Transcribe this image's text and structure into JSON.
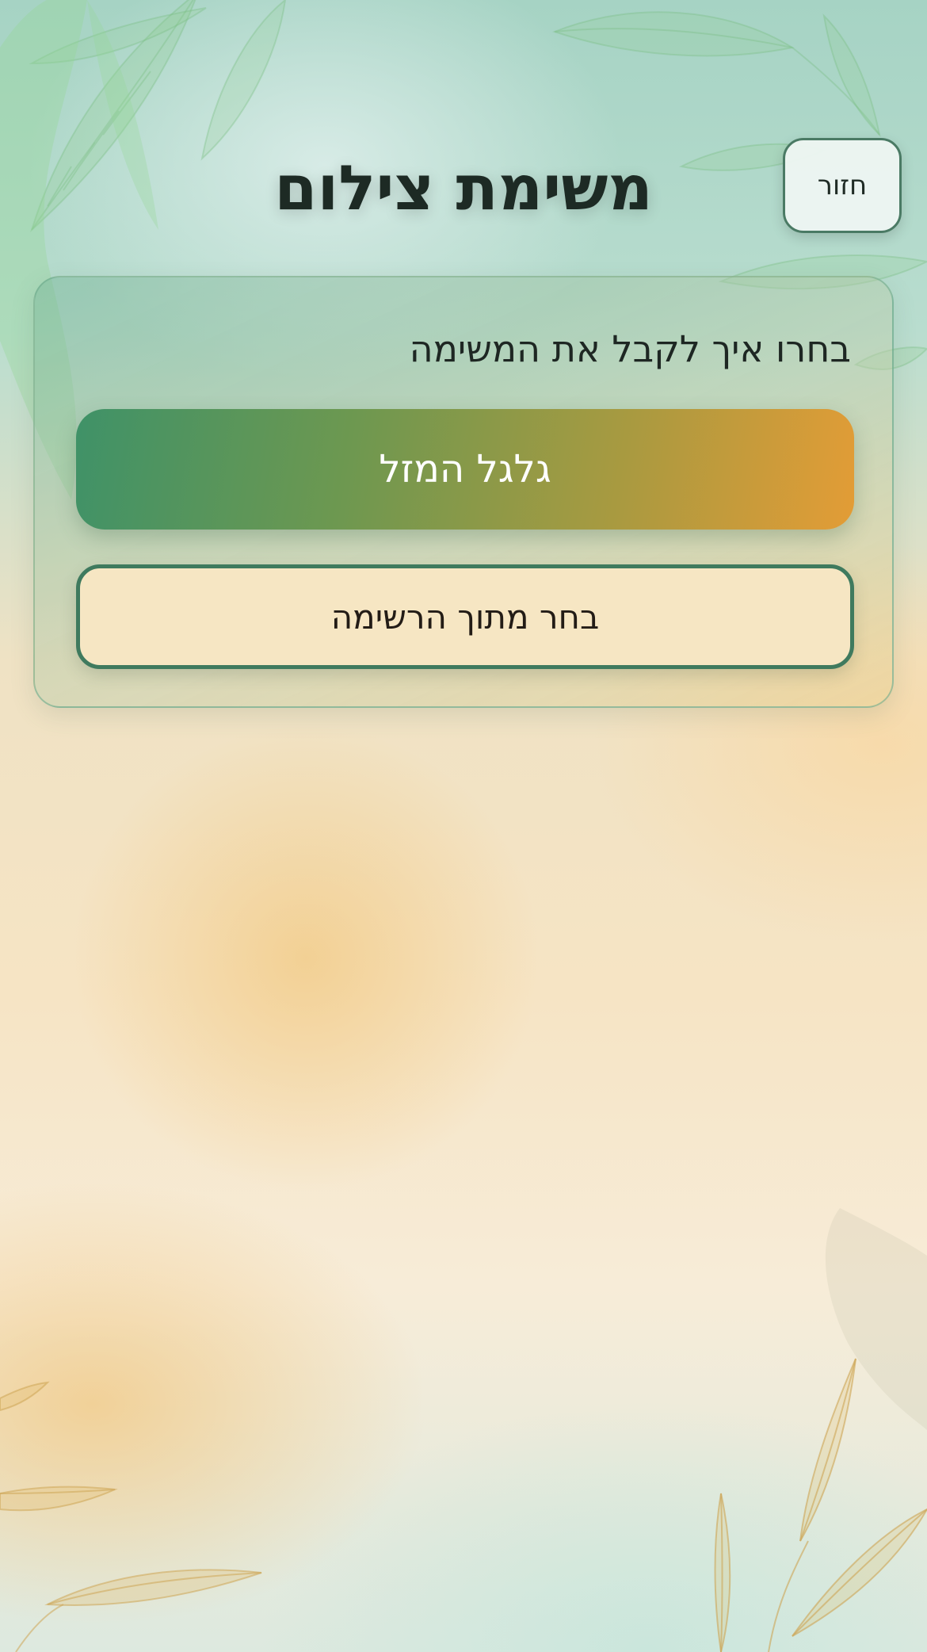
{
  "header": {
    "title": "משימת צילום",
    "back_label": "חזור"
  },
  "card": {
    "heading": "בחרו איך לקבל את המשימה",
    "wheel_button_label": "גלגל המזל",
    "list_button_label": "בחר מתוך הרשימה"
  },
  "colors": {
    "accent_green": "#3f7a5e",
    "gradient_start": "#3f9268",
    "gradient_end": "#e39c36",
    "cream": "#f6e6c3"
  }
}
